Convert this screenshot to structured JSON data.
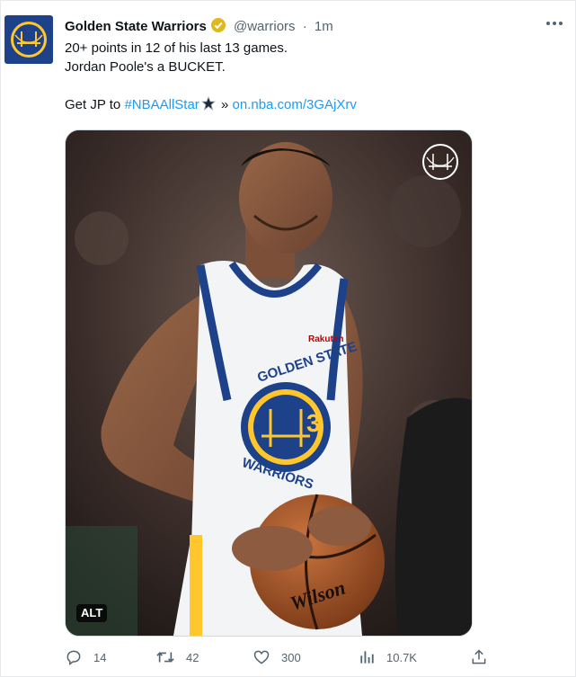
{
  "author": {
    "display_name": "Golden State Warriors",
    "handle": "@warriors",
    "separator": "·",
    "time": "1m"
  },
  "tweet": {
    "lines": [
      "20+ points in 12 of his last 13 games.",
      "Jordan Poole's a BUCKET."
    ],
    "cta_prefix": "Get JP to ",
    "hashtag": "#NBAAllStar",
    "arrow": "»",
    "url": "on.nba.com/3GAjXrv"
  },
  "media": {
    "alt_label": "ALT",
    "jersey_number": "3",
    "jersey_text_top": "GOLDEN STATE",
    "jersey_text_bottom": "WARRIORS",
    "sponsor": "Rakuten",
    "ball_brand": "Wilson"
  },
  "actions": {
    "reply_count": "14",
    "retweet_count": "42",
    "like_count": "300",
    "views_count": "10.7K"
  },
  "icons": {
    "avatar": "warriors-logo-icon",
    "verified": "verified-badge-icon",
    "more": "more-horizontal-icon",
    "reply": "reply-icon",
    "retweet": "retweet-icon",
    "like": "heart-icon",
    "views": "views-icon",
    "share": "share-icon"
  },
  "colors": {
    "link": "#1d9bf0",
    "secondary_text": "#536471",
    "warriors_blue": "#1d428a",
    "warriors_gold": "#ffc72c",
    "verified_gold": "#e2b719"
  }
}
